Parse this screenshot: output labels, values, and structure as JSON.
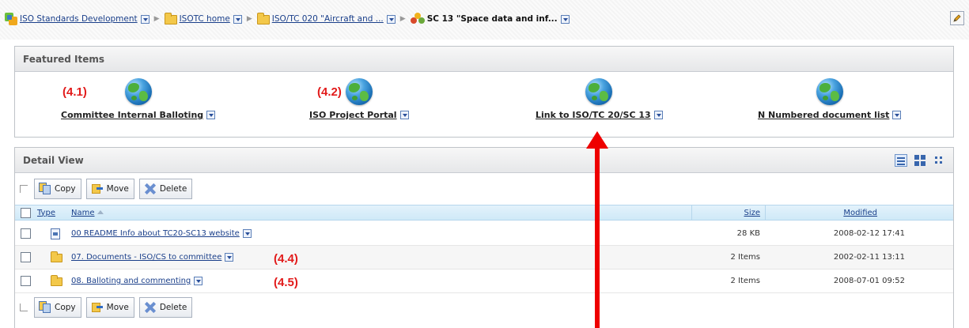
{
  "breadcrumb": {
    "items": [
      {
        "label": "ISO Standards Development",
        "icon": "site-icon"
      },
      {
        "label": "ISOTC home",
        "icon": "folder-icon"
      },
      {
        "label": "ISO/TC 020 \"Aircraft and ...",
        "icon": "folder-icon"
      },
      {
        "label": "SC 13 \"Space data and inf...",
        "icon": "committee-icon"
      }
    ]
  },
  "featured": {
    "title": "Featured Items",
    "items": [
      {
        "label": "Committee Internal Balloting",
        "icon": "globe-icon"
      },
      {
        "label": "ISO Project Portal",
        "icon": "globe-icon"
      },
      {
        "label": "Link to ISO/TC 20/SC 13",
        "icon": "globe-icon"
      },
      {
        "label": "N Numbered document list",
        "icon": "globe-icon"
      }
    ]
  },
  "annotations": {
    "a41": "(4.1)",
    "a42": "(4.2)",
    "a44": "(4.4)",
    "a45": "(4.5)"
  },
  "detail": {
    "title": "Detail View",
    "toolbar": {
      "copy": "Copy",
      "move": "Move",
      "delete": "Delete"
    },
    "columns": {
      "type": "Type",
      "name": "Name",
      "size": "Size",
      "modified": "Modified"
    },
    "rows": [
      {
        "name": "00 README Info about TC20-SC13 website",
        "size": "28 KB",
        "modified": "2008-02-12 17:41",
        "icon": "document-icon"
      },
      {
        "name": "07. Documents - ISO/CS to committee",
        "size": "2 Items",
        "modified": "2002-02-11 13:11",
        "icon": "folder-icon"
      },
      {
        "name": "08. Balloting and commenting",
        "size": "2 Items",
        "modified": "2008-07-01 09:52",
        "icon": "folder-icon"
      }
    ]
  },
  "colors": {
    "annotation": "#e21b1b",
    "link": "#1a3f8a",
    "arrow": "#ee0000"
  }
}
